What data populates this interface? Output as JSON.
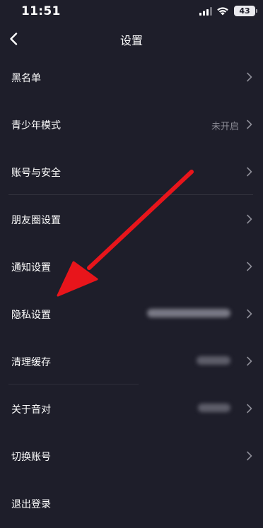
{
  "status": {
    "time": "11:51",
    "battery": "43",
    "signal_icon": "signal-icon",
    "wifi_icon": "wifi-icon"
  },
  "nav": {
    "title": "设置",
    "back_icon": "chevron-left-icon"
  },
  "settings": {
    "items": [
      {
        "label": "黑名单",
        "value": ""
      },
      {
        "label": "青少年模式",
        "value": "未开启"
      },
      {
        "label": "账号与安全",
        "value": ""
      },
      {
        "label": "朋友圈设置",
        "value": ""
      },
      {
        "label": "通知设置",
        "value": ""
      },
      {
        "label": "隐私设置",
        "value": ""
      },
      {
        "label": "清理缓存",
        "value": ""
      },
      {
        "label": "关于音对",
        "value": ""
      },
      {
        "label": "切换账号",
        "value": ""
      },
      {
        "label": "退出登录",
        "value": ""
      }
    ]
  },
  "colors": {
    "background": "#1e1e2a",
    "text": "#ffffff",
    "secondary_text": "#8c8c96",
    "annotation_arrow": "#e8151b"
  }
}
